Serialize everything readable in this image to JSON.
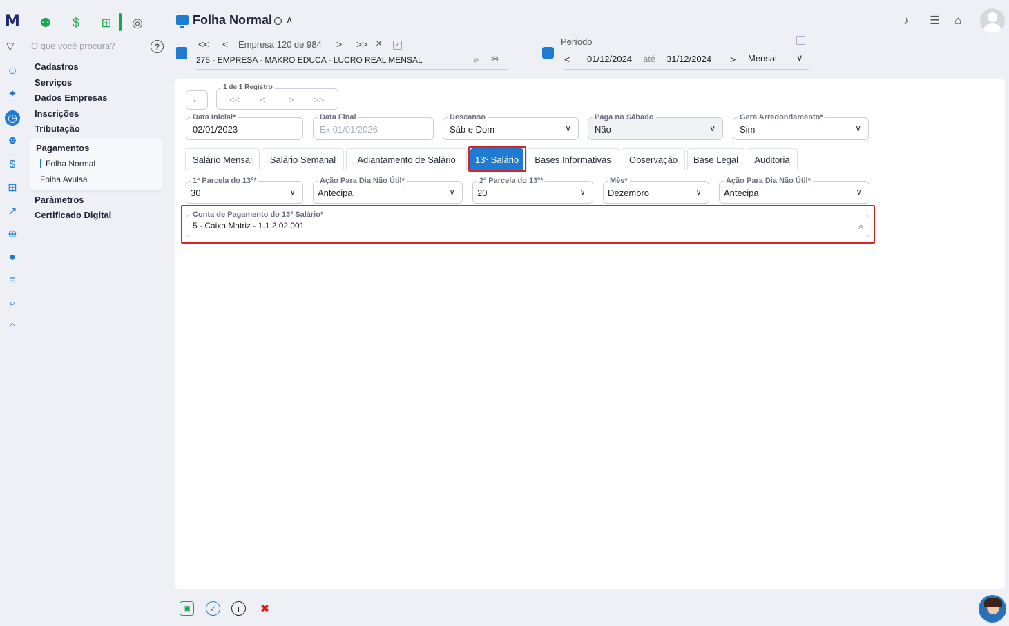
{
  "rail": {
    "logo": "M",
    "icons": [
      "user-gear-icon",
      "handshake-icon",
      "clock-icon",
      "users-icon",
      "dollar-circle-icon",
      "calculator-icon",
      "person-walk-icon",
      "globe-icon",
      "money-bag-icon",
      "layers-icon",
      "search-icon",
      "home-icon"
    ]
  },
  "modules": {
    "icons": [
      "people-icon",
      "dollar-icon",
      "grid-icon",
      "money-bag-icon"
    ]
  },
  "search": {
    "placeholder": "O que você procura?",
    "help": "?"
  },
  "menu": {
    "items": [
      "Cadastros",
      "Serviços",
      "Dados Empresas",
      "Inscrições",
      "Tributação"
    ],
    "group_title": "Pagamentos",
    "group_items": [
      "Folha Normal",
      "Folha Avulsa"
    ],
    "items_after": [
      "Parâmetros",
      "Certificado Digital"
    ]
  },
  "header": {
    "title": "Folha Normal",
    "info_icon": "i",
    "empresa_counter": "Empresa 120 de 984",
    "empresa_name": "275 - EMPRESA - MAKRO EDUCA - LUCRO REAL MENSAL",
    "nav_first": "<<",
    "nav_prev": "<",
    "nav_next": ">",
    "nav_last": ">>",
    "close": "×",
    "periodo_label": "Período",
    "periodo_start": "01/12/2024",
    "periodo_ate": "até",
    "periodo_end": "31/12/2024",
    "periodo_tipo": "Mensal"
  },
  "record_nav": {
    "label": "1 de 1 Registro",
    "first": "<<",
    "prev": "<",
    "next": ">",
    "last": ">>"
  },
  "fields_row1": [
    {
      "label": "Data Inicial*",
      "value": "02/01/2023"
    },
    {
      "label": "Data Final",
      "placeholder": "Ex 01/01/2026"
    },
    {
      "label": "Descanso",
      "value": "Sáb e Dom"
    },
    {
      "label": "Paga no Sábado",
      "value": "Não"
    },
    {
      "label": "Gera Arredondamento*",
      "value": "Sim"
    }
  ],
  "tabs": [
    "Salário Mensal",
    "Salário Semanal",
    "Adiantamento de Salário",
    "13º Salário",
    "Bases Informativas",
    "Observação",
    "Base Legal",
    "Auditoria"
  ],
  "active_tab": "13º Salário",
  "fields_row2": [
    {
      "label": "1ª Parcela do 13º*",
      "value": "30"
    },
    {
      "label": "Ação Para Dia Não Útil*",
      "value": "Antecipa"
    },
    {
      "label": "2ª Parcela do 13º*",
      "value": "20"
    },
    {
      "label": "Mês*",
      "value": "Dezembro"
    },
    {
      "label": "Ação Para Dia Não Útil*",
      "value": "Antecipa"
    }
  ],
  "conta": {
    "label": "Conta de Pagamento do 13º Salário*",
    "value": "5 - Caixa Matriz  - 1.1.2.02.001"
  },
  "colors": {
    "accent": "#1f7ad1",
    "highlight": "#d8232a",
    "green": "#1aa64b"
  }
}
